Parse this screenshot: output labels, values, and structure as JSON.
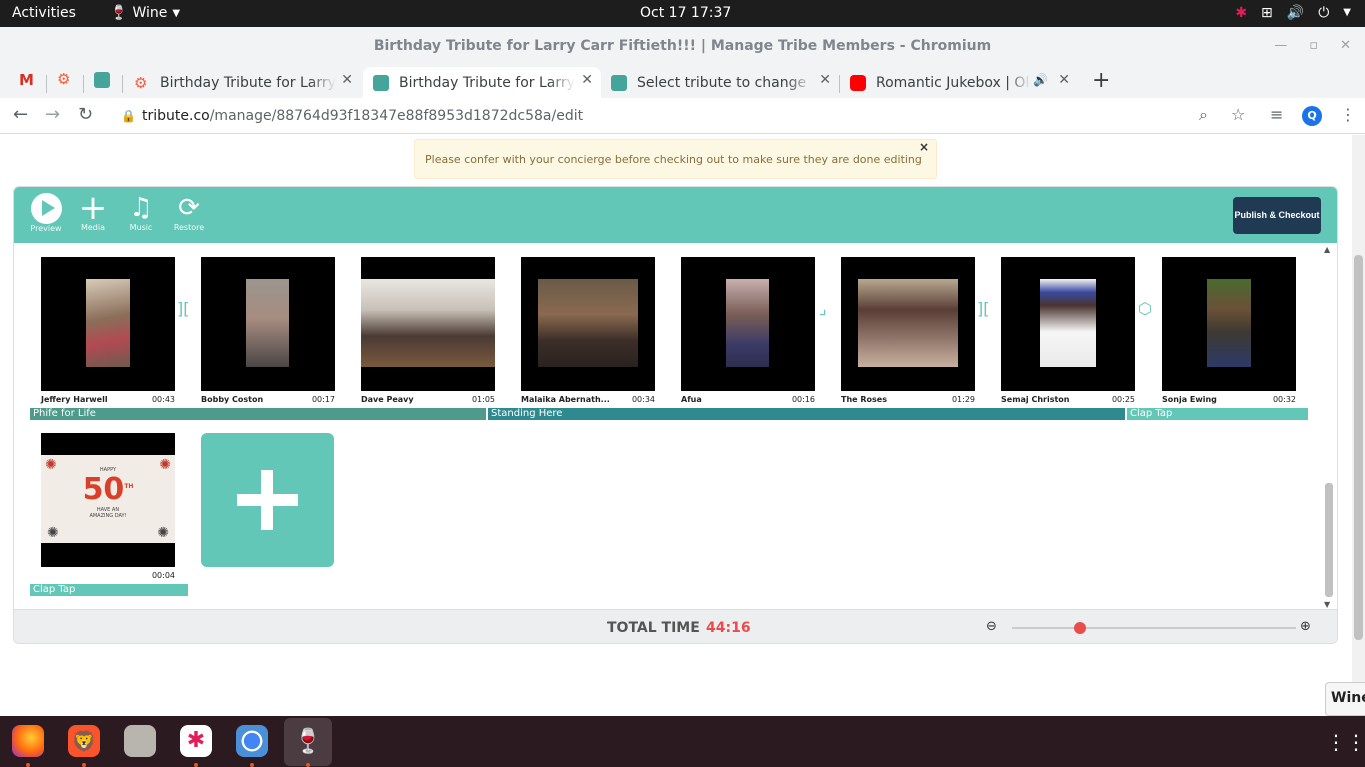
{
  "topbar": {
    "activities": "Activities",
    "app_name": "Wine",
    "clock": "Oct 17  17:37"
  },
  "window": {
    "title": "Birthday Tribute for Larry Carr Fiftieth!!! | Manage Tribe Members - Chromium"
  },
  "tabs": [
    {
      "label": "Birthday Tribute for Larry Carr Fiftieth!!!",
      "favicon_color": "#ff5a36",
      "active": false
    },
    {
      "label": "Birthday Tribute for Larry Carr Fiftieth!!!",
      "favicon_color": "#45a59a",
      "active": true
    },
    {
      "label": "Select tribute to change | Django site admin",
      "favicon_color": "#45a59a",
      "active": false
    },
    {
      "label": "Romantic Jukebox | Old Songs",
      "favicon_color": "#ff0000",
      "active": false
    }
  ],
  "pinned_tabs": [
    {
      "icon": "gmail-icon",
      "color": "#d93025"
    },
    {
      "icon": "hubspot-icon",
      "color": "#ff5a36"
    },
    {
      "icon": "tribute-icon",
      "color": "#45a59a"
    }
  ],
  "address_bar": {
    "host": "tribute.co",
    "path": "/manage/88764d93f18347e88f8953d1872dc58a/edit"
  },
  "profile_initial": "Q",
  "alert": {
    "message": "Please confer with your concierge before checking out to make sure they are done editing your video",
    "close": "×"
  },
  "toolbar": {
    "preview_label": "Preview",
    "media_label": "Media",
    "music_label": "Music",
    "restore_label": "Restore",
    "publish_label": "Publish & Checkout"
  },
  "clips": [
    {
      "name": "Jeffery Harwell",
      "duration": "00:43"
    },
    {
      "name": "Bobby Coston",
      "duration": "00:17"
    },
    {
      "name": "Dave Peavy",
      "duration": "01:05"
    },
    {
      "name": "Malaika Abernath...",
      "duration": "00:34"
    },
    {
      "name": "Afua",
      "duration": "00:16"
    },
    {
      "name": "The Roses",
      "duration": "01:29"
    },
    {
      "name": "Semaj Christon",
      "duration": "00:25"
    },
    {
      "name": "Sonja Ewing",
      "duration": "00:32"
    },
    {
      "name": "",
      "duration": "00:04"
    }
  ],
  "card": {
    "line1": "HAPPY",
    "number": "50",
    "th": "TH",
    "line2": "HAVE AN",
    "line3": "AMAZING DAY!"
  },
  "music_tracks": [
    {
      "title": "Phife for Life",
      "color": "#4e9a8b"
    },
    {
      "title": "Standing Here",
      "color": "#2f8a8f"
    },
    {
      "title": "Clap Tap",
      "color": "#63c7b8"
    },
    {
      "title": "Clap Tap",
      "color": "#63c7b8"
    }
  ],
  "footer": {
    "total_label": "TOTAL TIME",
    "total_value": "44:16",
    "zoom_level": 0.24
  },
  "dock_popup": "Wine"
}
